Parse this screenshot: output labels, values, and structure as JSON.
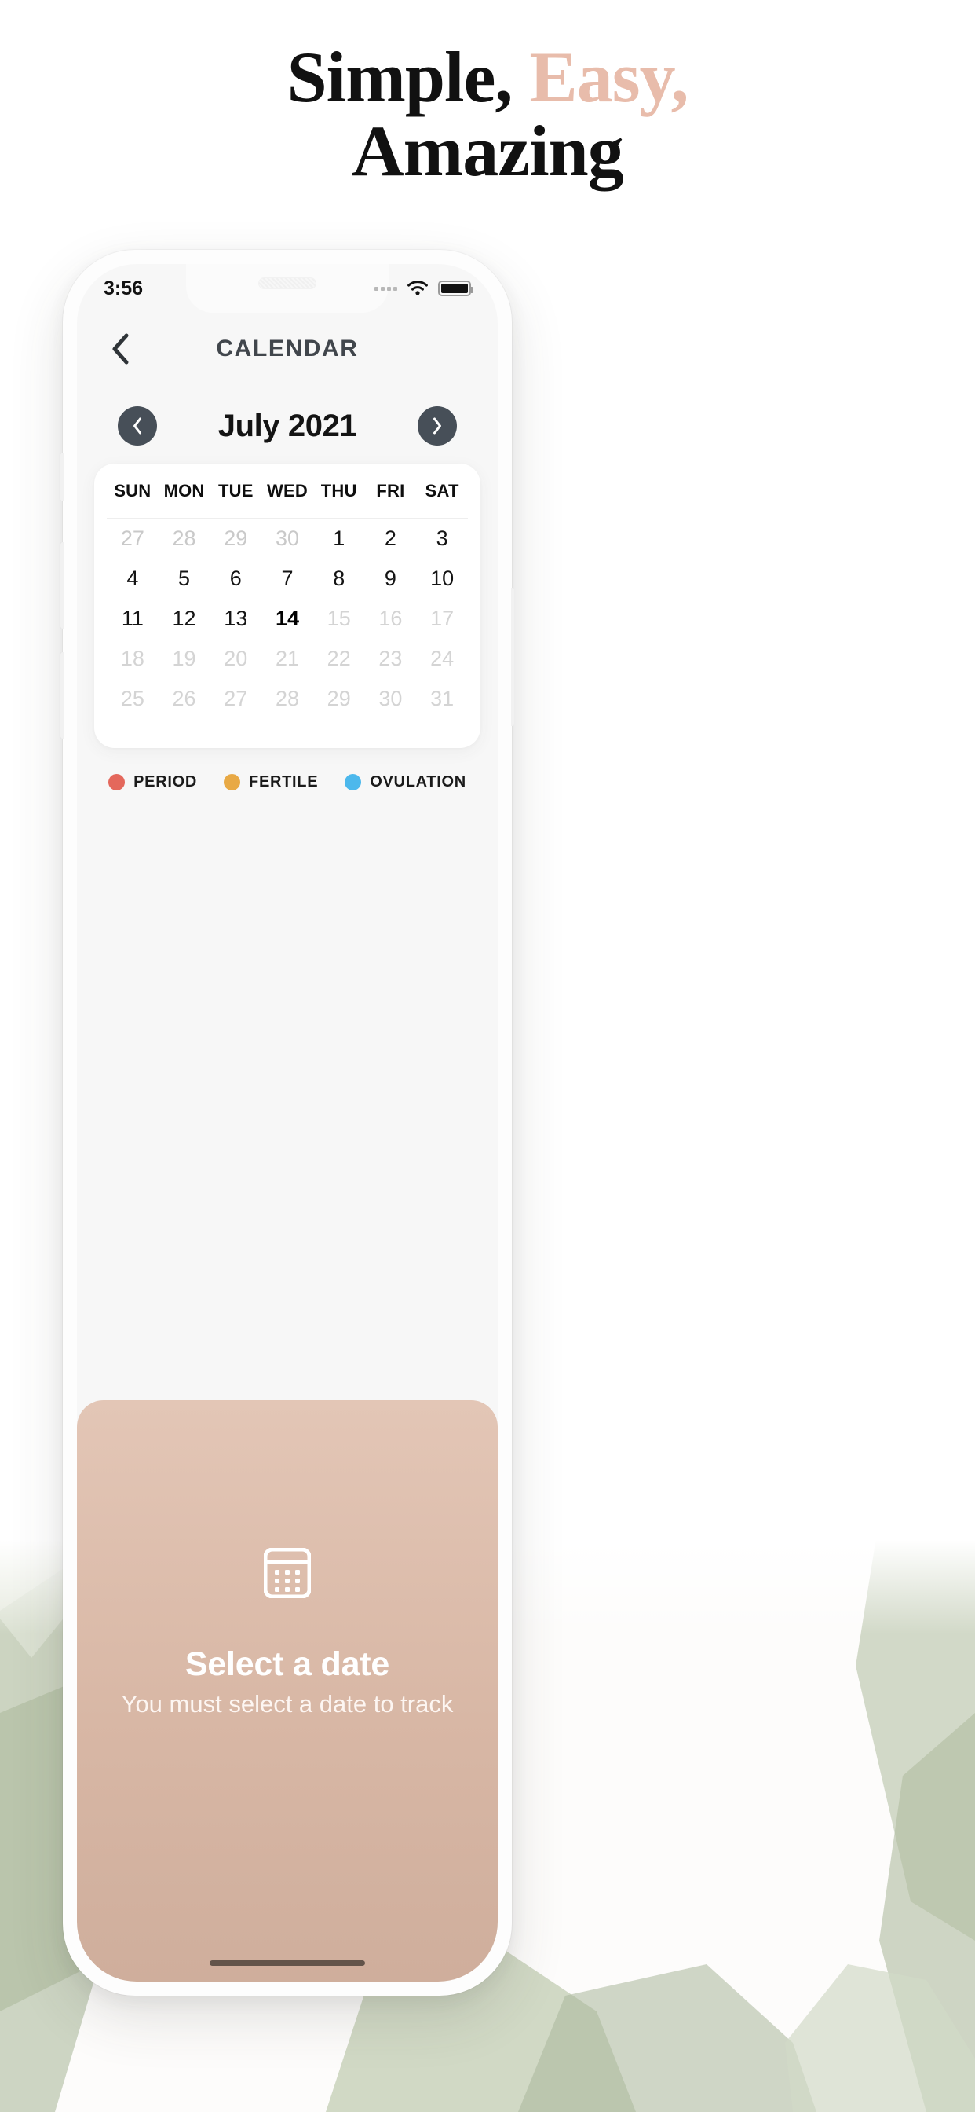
{
  "page": {
    "background_color": "#ffffff",
    "accent_color": "#e8bcab",
    "botanical_color": "#b9c4ad"
  },
  "headline": {
    "part1": "Simple, ",
    "part2": "Easy,",
    "line2": "Amazing"
  },
  "phone": {
    "status_bar": {
      "time": "3:56",
      "wifi_icon": "wifi-icon",
      "battery_icon": "battery-icon",
      "cellular_icon": "signal-dots-icon"
    },
    "nav": {
      "back_icon": "chevron-left-icon",
      "title": "CALENDAR"
    },
    "month_nav": {
      "prev_icon": "chevron-left-circle-icon",
      "next_icon": "chevron-right-circle-icon",
      "label": "July 2021"
    },
    "calendar": {
      "weekdays": [
        "SUN",
        "MON",
        "TUE",
        "WED",
        "THU",
        "FRI",
        "SAT"
      ],
      "weeks": [
        [
          {
            "n": "27",
            "state": "muted"
          },
          {
            "n": "28",
            "state": "muted"
          },
          {
            "n": "29",
            "state": "muted"
          },
          {
            "n": "30",
            "state": "muted"
          },
          {
            "n": "1",
            "state": "active"
          },
          {
            "n": "2",
            "state": "active"
          },
          {
            "n": "3",
            "state": "active"
          }
        ],
        [
          {
            "n": "4",
            "state": "active"
          },
          {
            "n": "5",
            "state": "active"
          },
          {
            "n": "6",
            "state": "active"
          },
          {
            "n": "7",
            "state": "active"
          },
          {
            "n": "8",
            "state": "active"
          },
          {
            "n": "9",
            "state": "active"
          },
          {
            "n": "10",
            "state": "active"
          }
        ],
        [
          {
            "n": "11",
            "state": "active"
          },
          {
            "n": "12",
            "state": "active"
          },
          {
            "n": "13",
            "state": "active"
          },
          {
            "n": "14",
            "state": "today"
          },
          {
            "n": "15",
            "state": "dim"
          },
          {
            "n": "16",
            "state": "dim"
          },
          {
            "n": "17",
            "state": "dim"
          }
        ],
        [
          {
            "n": "18",
            "state": "dim"
          },
          {
            "n": "19",
            "state": "dim"
          },
          {
            "n": "20",
            "state": "dim"
          },
          {
            "n": "21",
            "state": "dim"
          },
          {
            "n": "22",
            "state": "dim"
          },
          {
            "n": "23",
            "state": "dim"
          },
          {
            "n": "24",
            "state": "dim"
          }
        ],
        [
          {
            "n": "25",
            "state": "dim"
          },
          {
            "n": "26",
            "state": "dim"
          },
          {
            "n": "27",
            "state": "dim"
          },
          {
            "n": "28",
            "state": "dim"
          },
          {
            "n": "29",
            "state": "dim"
          },
          {
            "n": "30",
            "state": "dim"
          },
          {
            "n": "31",
            "state": "dim"
          }
        ]
      ]
    },
    "legend": [
      {
        "label": "PERIOD",
        "color": "#e4685c"
      },
      {
        "label": "FERTILE",
        "color": "#e8a945"
      },
      {
        "label": "OVULATION",
        "color": "#4cb8ec"
      }
    ],
    "bottom_panel": {
      "icon": "calendar-icon",
      "title": "Select a date",
      "subtitle": "You must select a date to track",
      "background_color": "#d8b7a5"
    }
  }
}
